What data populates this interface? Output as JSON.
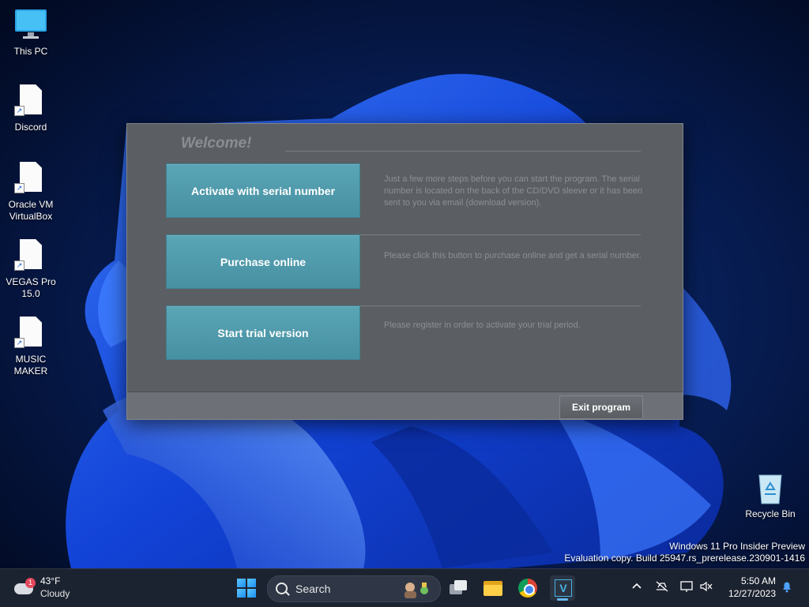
{
  "desktop": {
    "icons": [
      {
        "label": "This PC"
      },
      {
        "label": "Discord"
      },
      {
        "label": "Oracle VM VirtualBox"
      },
      {
        "label": "VEGAS Pro 15.0"
      },
      {
        "label": "MUSIC MAKER"
      },
      {
        "label": "Recycle Bin"
      }
    ],
    "watermark": {
      "line1": "Windows 11 Pro Insider Preview",
      "line2": "Evaluation copy. Build 25947.rs_prerelease.230901-1416"
    }
  },
  "dialog": {
    "title": "Welcome!",
    "options": [
      {
        "button": "Activate with serial number",
        "description": "Just a few more steps before you can start the program. The serial number is located on the back of the CD/DVD sleeve or it has been sent to you via email (download version)."
      },
      {
        "button": "Purchase online",
        "description": "Please click this button to purchase online and get a serial number."
      },
      {
        "button": "Start trial version",
        "description": "Please register in order to activate your trial period."
      }
    ],
    "exit_label": "Exit program"
  },
  "taskbar": {
    "weather": {
      "temp": "43°F",
      "condition": "Cloudy",
      "badge": "1"
    },
    "search_label": "Search",
    "clock": {
      "time": "5:50 AM",
      "date": "12/27/2023"
    },
    "vegas_glyph": "V"
  },
  "colors": {
    "dialog_bg": "#5b5e63",
    "button_accent": "#4f9bad",
    "taskbar_bg": "#1c2330"
  }
}
